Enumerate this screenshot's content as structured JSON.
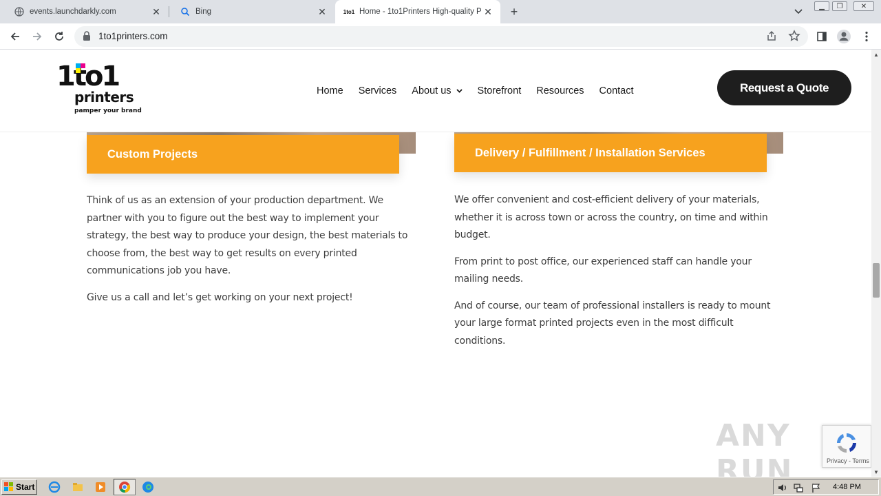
{
  "browser": {
    "tabs": [
      {
        "title": "events.launchdarkly.com",
        "icon": "globe-icon",
        "active": false
      },
      {
        "title": "Bing",
        "icon": "bing-search-icon",
        "active": false
      },
      {
        "title": "Home - 1to1Printers High-quality Prin",
        "icon": "site-favicon",
        "favicon_text": "1to1",
        "active": true
      }
    ],
    "url": "1to1printers.com"
  },
  "site": {
    "logo": {
      "line1": "1to1",
      "line2": "printers",
      "tagline": "pamper your brand"
    },
    "nav": [
      {
        "label": "Home"
      },
      {
        "label": "Services"
      },
      {
        "label": "About us",
        "has_dropdown": true
      },
      {
        "label": "Storefront"
      },
      {
        "label": "Resources"
      },
      {
        "label": "Contact"
      }
    ],
    "cta_label": "Request a Quote",
    "cards": [
      {
        "title": "Custom Projects",
        "paragraphs": [
          "Think of us as an extension of your production department.  We partner with you to figure out the best way to implement your strategy, the best way to produce your design, the best materials to choose from, the best way to get results on every printed communications job you have.",
          "Give us a call and let’s get working on your next project!"
        ]
      },
      {
        "title": "Delivery / Fulfillment / Installation Services",
        "paragraphs": [
          "We offer convenient and cost-efficient delivery of your materials, whether it is across town or across the country, on time and within budget.",
          "From print to post office, our experienced staff can handle your mailing needs.",
          "And of course, our team of professional installers is ready to mount your large format printed projects even in the most difficult conditions."
        ]
      }
    ],
    "accent_color": "#f7a21e",
    "recaptcha_text": "Privacy - Terms",
    "watermark_text": "ANY RUN"
  },
  "taskbar": {
    "start_label": "Start",
    "clock": "4:48 PM"
  }
}
